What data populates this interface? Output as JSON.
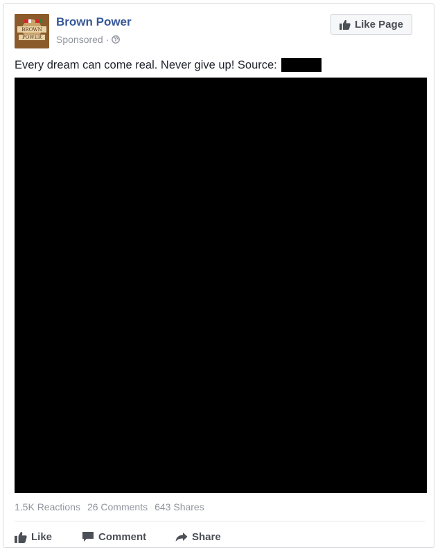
{
  "post": {
    "page_name": "Brown Power",
    "sponsored": "Sponsored",
    "separator": "·",
    "globe_icon": "globe-icon",
    "like_page_label": "Like Page",
    "caption": "Every dream can come real. Never give up! Source:",
    "media": "redacted-image",
    "stats": {
      "reactions": "1.5K Reactions",
      "comments": "26 Comments",
      "shares": "643 Shares"
    },
    "actions": {
      "like": "Like",
      "comment": "Comment",
      "share": "Share"
    },
    "avatar_logo_text": [
      "BROWN",
      "POWER"
    ],
    "colors": {
      "link": "#365899",
      "meta": "#90949c",
      "text": "#1d2129",
      "avatar_bg": "#8a5a2a"
    }
  }
}
